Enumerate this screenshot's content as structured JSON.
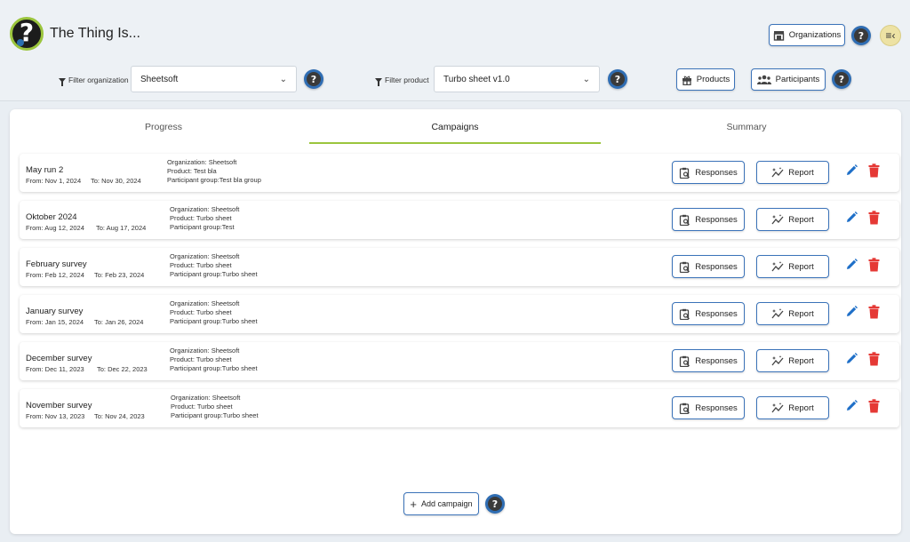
{
  "app": {
    "title": "The Thing Is..."
  },
  "header": {
    "organizations_label": "Organizations",
    "products_label": "Products",
    "participants_label": "Participants",
    "filter_org_label": "Filter organization",
    "filter_org_value": "Sheetsoft",
    "filter_product_label": "Filter product",
    "filter_product_value": "Turbo sheet v1.0"
  },
  "tabs": [
    {
      "label": "Progress"
    },
    {
      "label": "Campaigns"
    },
    {
      "label": "Summary"
    }
  ],
  "campaigns": [
    {
      "name": "May run 2",
      "from": "From: Nov 1, 2024",
      "to": "To: Nov 30, 2024",
      "organization": "Organization: Sheetsoft",
      "product": "Product: Test bla",
      "group": "Participant group:Test bla group"
    },
    {
      "name": "Oktober 2024",
      "from": "From: Aug 12, 2024",
      "to": "To: Aug 17, 2024",
      "organization": "Organization: Sheetsoft",
      "product": "Product: Turbo sheet",
      "group": "Participant group:Test"
    },
    {
      "name": "February survey",
      "from": "From: Feb 12, 2024",
      "to": "To: Feb 23, 2024",
      "organization": "Organization: Sheetsoft",
      "product": "Product: Turbo sheet",
      "group": "Participant group:Turbo sheet"
    },
    {
      "name": "January survey",
      "from": "From: Jan 15, 2024",
      "to": "To: Jan 26, 2024",
      "organization": "Organization: Sheetsoft",
      "product": "Product: Turbo sheet",
      "group": "Participant group:Turbo sheet"
    },
    {
      "name": "December survey",
      "from": "From: Dec 11, 2023",
      "to": "To: Dec 22, 2023",
      "organization": "Organization: Sheetsoft",
      "product": "Product: Turbo sheet",
      "group": "Participant group:Turbo sheet"
    },
    {
      "name": "November survey",
      "from": "From: Nov 13, 2023",
      "to": "To: Nov 24, 2023",
      "organization": "Organization: Sheetsoft",
      "product": "Product: Turbo sheet",
      "group": "Participant group:Turbo sheet"
    }
  ],
  "row_actions": {
    "responses_label": "Responses",
    "report_label": "Report"
  },
  "footer": {
    "add_campaign_label": "Add campaign"
  },
  "colors": {
    "accent": "#3b73b9",
    "tab_underline": "#9bc53d",
    "delete": "#e53935",
    "edit": "#1e6fc8"
  },
  "icons": {
    "logo": "question-mark-logo-icon",
    "organizations": "store-icon",
    "products": "gift-icon",
    "participants": "group-icon",
    "help": "help-circle-icon",
    "menu": "menu-collapse-icon",
    "filter": "funnel-icon",
    "responses": "clipboard-search-icon",
    "report": "sparkle-chart-icon",
    "edit": "pencil-icon",
    "delete": "trash-icon",
    "add": "plus-icon"
  }
}
